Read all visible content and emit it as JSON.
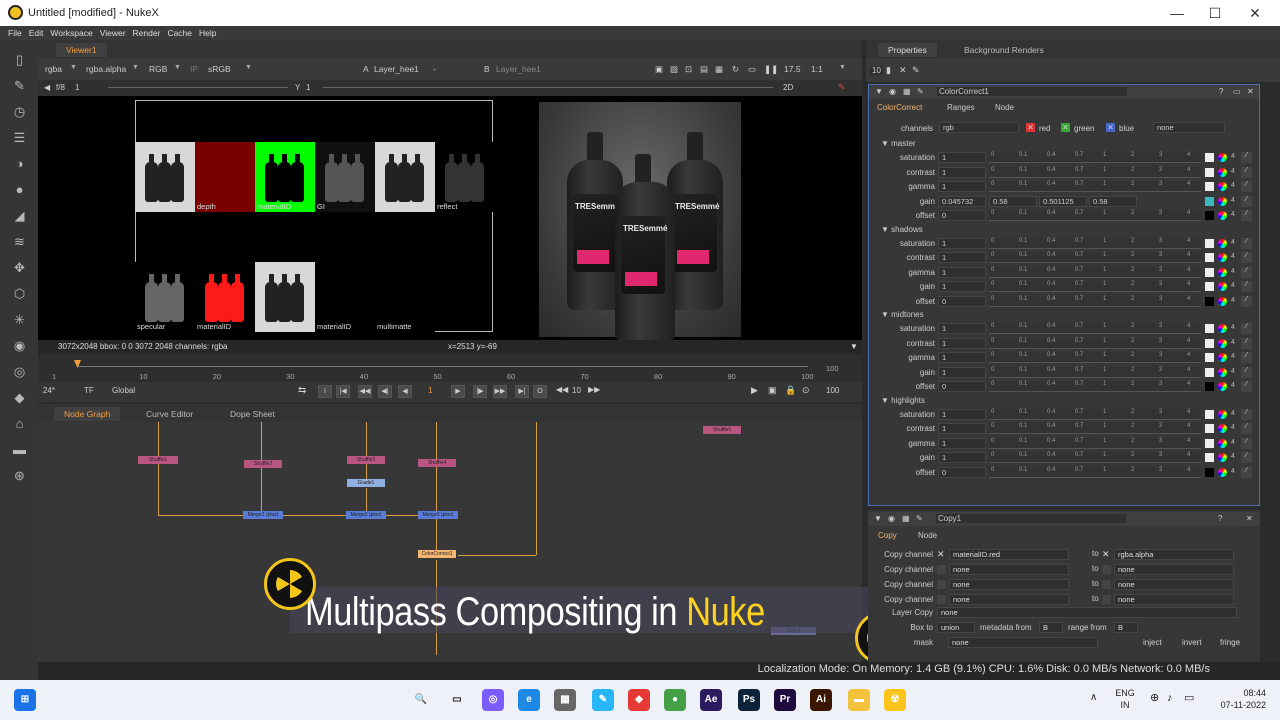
{
  "window": {
    "title": "Untitled [modified] - NukeX",
    "min": "—",
    "max": "☐",
    "close": "✕"
  },
  "menu": [
    "File",
    "Edit",
    "Workspace",
    "Viewer",
    "Render",
    "Cache",
    "Help"
  ],
  "viewer": {
    "tab": "Viewer1",
    "controls": {
      "channels": "rgba",
      "alpha": "rgba.alpha",
      "colorspace": "RGB",
      "ip": "IP",
      "lut": "sRGB",
      "a_label": "A",
      "a_input": "Layer_hee1",
      "dash": "-",
      "b_label": "B",
      "b_input": "Layer_hee1",
      "zoom_pct": "17.5",
      "ratio": "1:1",
      "fstop": "f/8",
      "frame": "1",
      "gain_val": "1",
      "mode": "2D"
    },
    "passes": [
      {
        "label": "",
        "bg": "#d8d8d8",
        "bottle": "#222"
      },
      {
        "label": "depth",
        "bg": "#7a0000",
        "bottle": "#7a0000"
      },
      {
        "label": "materialID",
        "bg": "#00ff00",
        "bottle": "#000"
      },
      {
        "label": "GI",
        "bg": "#101010",
        "bottle": "#555"
      },
      {
        "label": "",
        "bg": "#d8d8d8",
        "bottle": "#222"
      },
      {
        "label": "reflect",
        "bg": "#000",
        "bottle": "#333"
      },
      {
        "label": "specular",
        "bg": "#000",
        "bottle": "#666"
      },
      {
        "label": "materialID",
        "bg": "#000",
        "bottle": "#ff1a1a"
      },
      {
        "label": "",
        "bg": "#d8d8d8",
        "bottle": "#222"
      },
      {
        "label": "materialID",
        "bg": "#000",
        "bottle": "#000"
      },
      {
        "label": "multimatte",
        "bg": "#000",
        "bottle": "#000"
      }
    ],
    "brand": "TRESemmé",
    "info_left": "3072x2048  bbox: 0 0 3072 2048 channels: rgba",
    "info_coords": "x=2513 y=-69"
  },
  "timeline": {
    "ticks": [
      "1",
      "10",
      "20",
      "30",
      "40",
      "50",
      "60",
      "70",
      "80",
      "90",
      "100"
    ],
    "end": "100",
    "fps": "24*",
    "tf": "TF",
    "scope": "Global",
    "current": "1",
    "step": "10",
    "end2": "100"
  },
  "nodegraph": {
    "tabs": [
      "Node Graph",
      "Curve Editor",
      "Dope Sheet"
    ],
    "nodes": [
      {
        "label": "Shuffle1"
      },
      {
        "label": "Shuffle2"
      },
      {
        "label": "Shuffle3"
      },
      {
        "label": "Shuffle4"
      },
      {
        "label": "Shuffle5"
      },
      {
        "label": "Grade1"
      },
      {
        "label": "Merge1 (plus)"
      },
      {
        "label": "Merge2 (plus)"
      },
      {
        "label": "Merge3 (plus)"
      },
      {
        "label": "ColorCorrect1"
      },
      {
        "label": "Copy1"
      }
    ]
  },
  "banner": {
    "text1": "Multipass Compositing in ",
    "text2": "Nuke"
  },
  "status": "Localization Mode: On Memory: 1.4 GB (9.1%) CPU: 1.6% Disk: 0.0 MB/s Network: 0.0 MB/s",
  "properties": {
    "tabs": [
      "Properties",
      "Background Renders"
    ],
    "count": "10",
    "cc": {
      "name": "ColorCorrect1",
      "tabs": [
        "ColorCorrect",
        "Ranges",
        "Node"
      ],
      "channels_label": "channels",
      "channels": "rgb",
      "red": "red",
      "green": "green",
      "blue": "blue",
      "none": "none",
      "sections": [
        {
          "name": "master",
          "rows": [
            {
              "k": "saturation",
              "v": "1"
            },
            {
              "k": "contrast",
              "v": "1"
            },
            {
              "k": "gamma",
              "v": "1"
            },
            {
              "k": "gain",
              "v": "0.045732"
            },
            {
              "k": "offset",
              "v": "0"
            }
          ]
        },
        {
          "name": "shadows",
          "rows": [
            {
              "k": "saturation",
              "v": "1"
            },
            {
              "k": "contrast",
              "v": "1"
            },
            {
              "k": "gamma",
              "v": "1"
            },
            {
              "k": "gain",
              "v": "1"
            },
            {
              "k": "offset",
              "v": "0"
            }
          ]
        },
        {
          "name": "midtones",
          "rows": [
            {
              "k": "saturation",
              "v": "1"
            },
            {
              "k": "contrast",
              "v": "1"
            },
            {
              "k": "gamma",
              "v": "1"
            },
            {
              "k": "gain",
              "v": "1"
            },
            {
              "k": "offset",
              "v": "0"
            }
          ]
        },
        {
          "name": "highlights",
          "rows": [
            {
              "k": "saturation",
              "v": "1"
            },
            {
              "k": "contrast",
              "v": "1"
            },
            {
              "k": "gamma",
              "v": "1"
            },
            {
              "k": "gain",
              "v": "1"
            },
            {
              "k": "offset",
              "v": "0"
            }
          ]
        }
      ],
      "gain_extra": [
        "0.58",
        "0.501125",
        "0.58"
      ],
      "slider_ticks": [
        "0",
        "0.1",
        "0.4",
        "0.7",
        "1",
        "2",
        "3",
        "4"
      ]
    },
    "copy": {
      "name": "Copy1",
      "tabs": [
        "Copy",
        "Node"
      ],
      "rows": [
        {
          "k": "Copy channel",
          "from": "materialID.red",
          "to": "rgba.alpha"
        },
        {
          "k": "Copy channel",
          "from": "none",
          "to": "none"
        },
        {
          "k": "Copy channel",
          "from": "none",
          "to": "none"
        },
        {
          "k": "Copy channel",
          "from": "none",
          "to": "none"
        }
      ],
      "to_label": "to",
      "layer_copy": "Layer Copy",
      "layer_val": "none",
      "bbox_label": "Box to",
      "bbox_val": "union",
      "meta_label": "metadata from",
      "meta_val": "B",
      "range_label": "range from",
      "range_val": "B",
      "mask_label": "mask",
      "mask_val": "none",
      "inject": "inject",
      "invert": "invert",
      "fringe": "fringe"
    }
  },
  "taskbar": {
    "apps": [
      "⊞",
      "🔍",
      "▭",
      "◎",
      "e",
      "▦",
      "✎",
      "◆",
      "●",
      "Ae",
      "Ps",
      "Pr",
      "Ai",
      "▬",
      "☢"
    ],
    "lang1": "ENG",
    "lang2": "IN",
    "time": "08:44",
    "date": "07-11-2022"
  }
}
